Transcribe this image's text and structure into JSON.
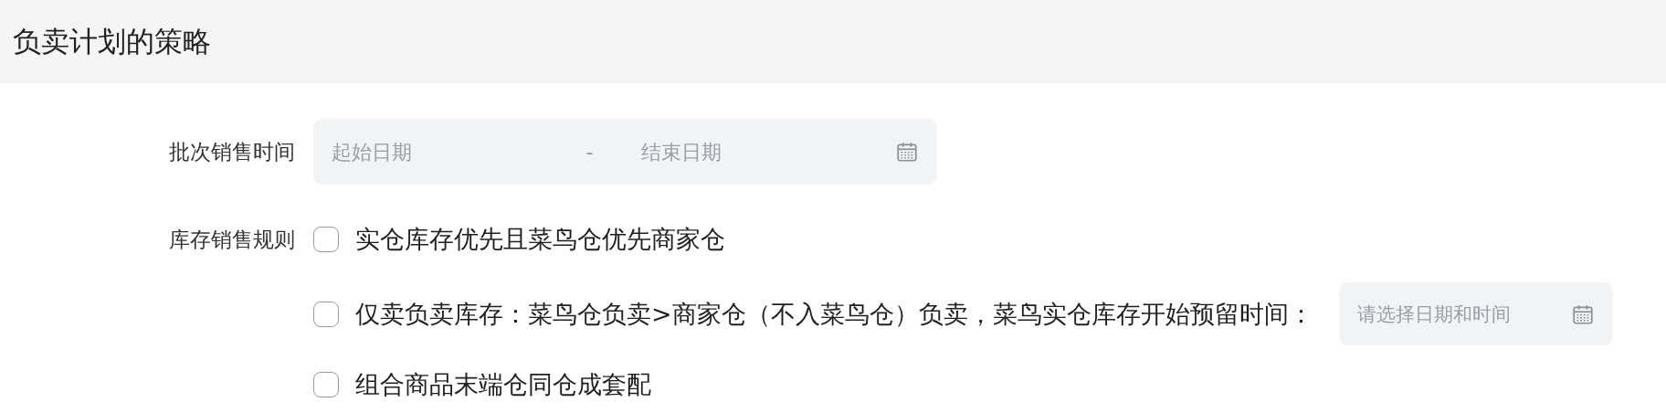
{
  "section": {
    "title": "负卖计划的策略"
  },
  "batch_time": {
    "label": "批次销售时间",
    "start_placeholder": "起始日期",
    "separator": "-",
    "end_placeholder": "结束日期"
  },
  "stock_rule": {
    "label": "库存销售规则",
    "options": [
      {
        "kind": "plain",
        "label": "实仓库存优先且菜鸟仓优先商家仓",
        "checked": false
      },
      {
        "kind": "datetime",
        "label": "仅卖负卖库存：菜鸟仓负卖>商家仓（不入菜鸟仓）负卖，菜鸟实仓库存开始预留时间：",
        "checked": false,
        "placeholder": "请选择日期和时间"
      },
      {
        "kind": "plain",
        "label": "组合商品末端仓同仓成套配",
        "checked": false
      }
    ]
  }
}
